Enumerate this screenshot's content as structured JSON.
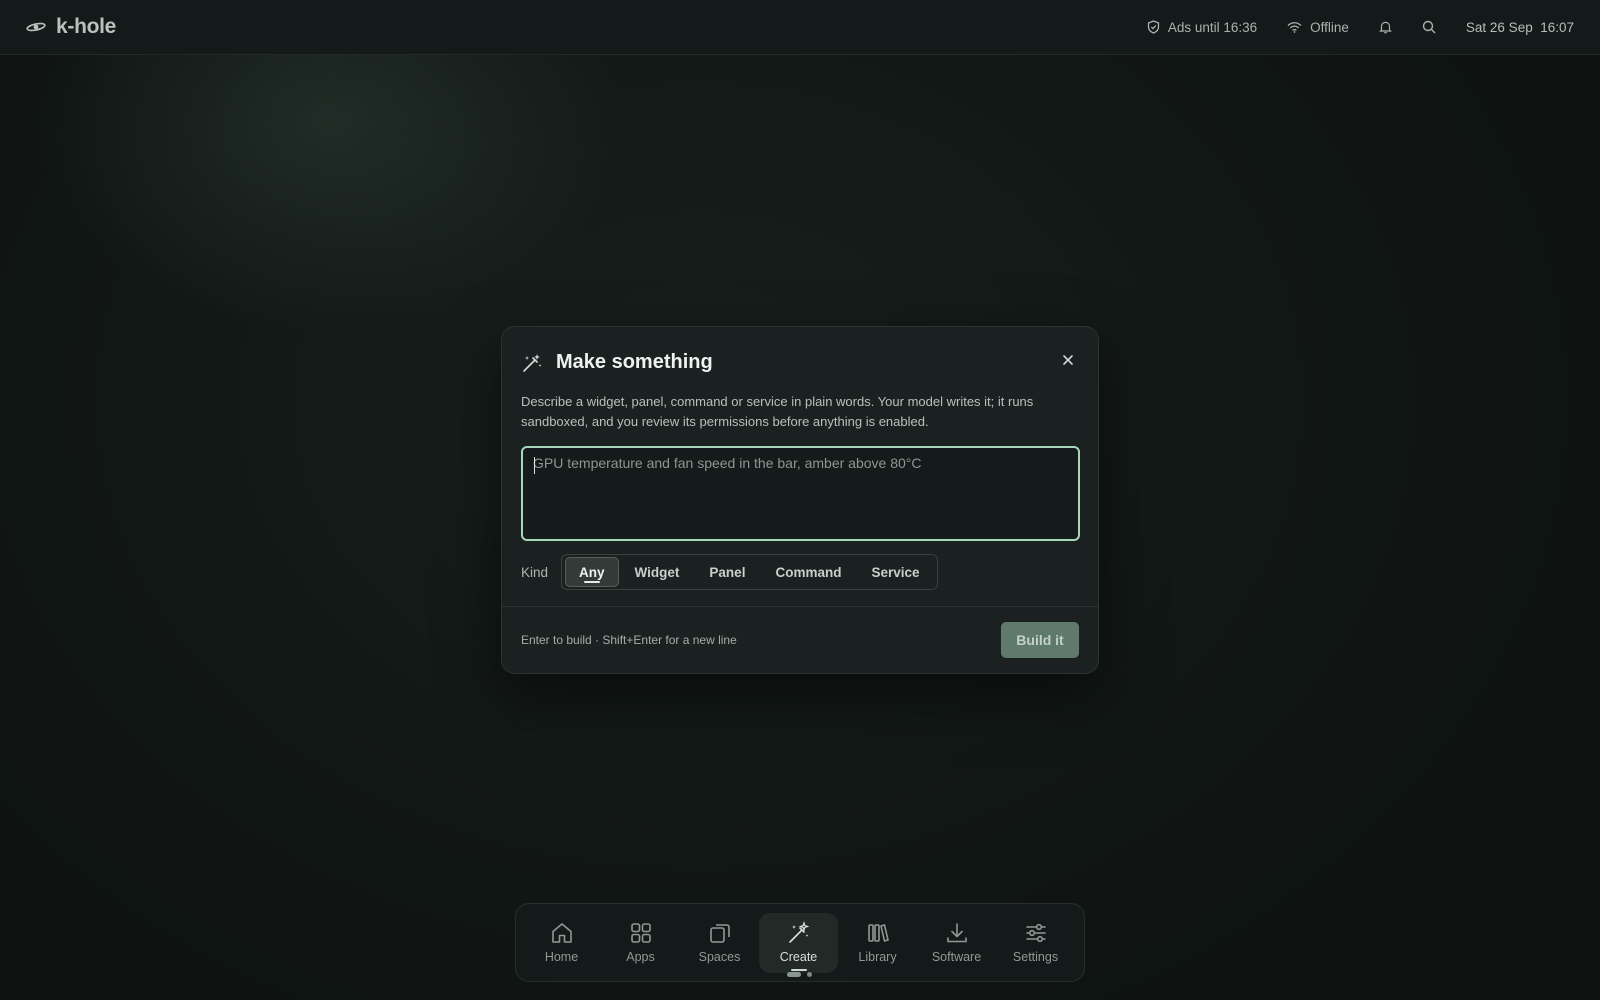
{
  "topbar": {
    "brand": "k-hole",
    "ads": "Ads until 16:36",
    "network": "Offline",
    "datetime": "Sat 26 Sep  16:07"
  },
  "dialog": {
    "title": "Make something",
    "description": "Describe a widget, panel, command or service in plain words. Your model writes it; it runs sandboxed, and you review its permissions before anything is enabled.",
    "prompt": {
      "value": "",
      "placeholder": "GPU temperature and fan speed in the bar, amber above 80°C"
    },
    "kind_label": "Kind",
    "kinds": [
      "Any",
      "Widget",
      "Panel",
      "Command",
      "Service"
    ],
    "selected_kind": "Any",
    "hint": "Enter to build · Shift+Enter for a new line",
    "build_label": "Build it"
  },
  "dock": {
    "items": [
      {
        "label": "Home",
        "icon": "home-icon"
      },
      {
        "label": "Apps",
        "icon": "grid-icon"
      },
      {
        "label": "Spaces",
        "icon": "spaces-icon"
      },
      {
        "label": "Create",
        "icon": "magic-wand-icon",
        "active": true
      },
      {
        "label": "Library",
        "icon": "library-icon"
      },
      {
        "label": "Software",
        "icon": "download-icon"
      },
      {
        "label": "Settings",
        "icon": "sliders-icon"
      }
    ],
    "page_count": 2,
    "current_page": 1
  },
  "colors": {
    "accent_focus": "#a7d7b9",
    "build_button": "#5f7a6d",
    "background": "#121816"
  }
}
